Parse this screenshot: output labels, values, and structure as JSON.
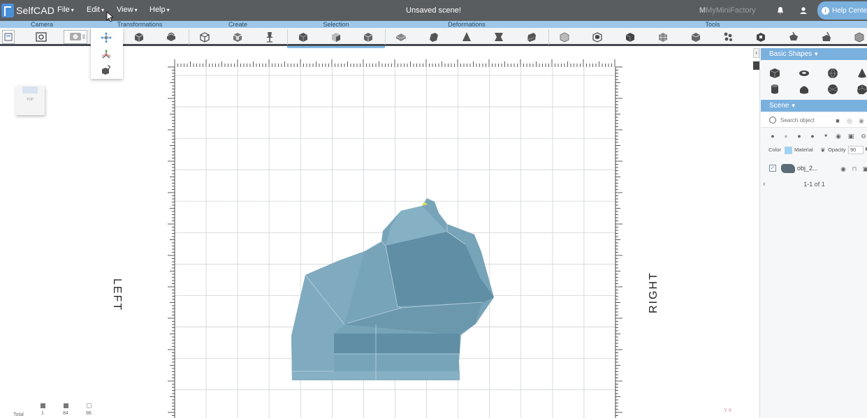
{
  "app": {
    "logo_text": "SelfCAD",
    "menus": [
      "File",
      "Edit",
      "View",
      "Help"
    ],
    "document_title": "Unsaved scene!",
    "partner_prefix": "M",
    "partner_name": "MyMiniFactory",
    "help_label": "Help Center",
    "accent": "#7ab0de",
    "topbar_color": "#5a5d60"
  },
  "ribbon": {
    "groups": [
      "Camera",
      "Transformations",
      "Create",
      "Selection",
      "Deformations",
      "Tools"
    ],
    "camera_tools": [
      "camera-top-view",
      "camera-reset",
      "camera-screenshot"
    ],
    "transform_tools": [
      "move",
      "rotate",
      "scale"
    ],
    "create_tools": [
      "box",
      "extrude",
      "pin"
    ],
    "selection_tools": [
      "select-face",
      "select-object",
      "select-edge"
    ],
    "deformation_tools": [
      "deform-1",
      "deform-2",
      "deform-3",
      "deform-4",
      "deform-5"
    ],
    "tools_tools": [
      "tool-1",
      "tool-2",
      "tool-3",
      "tool-4",
      "tool-5",
      "tool-6",
      "tool-7",
      "tool-8",
      "tool-9",
      "tool-10"
    ],
    "dropdown_items": [
      "move-gizmo",
      "rotate-gizmo",
      "scale-gizmo"
    ]
  },
  "viewport": {
    "view_cube_label": "TOP",
    "left_label": "LEFT",
    "right_label": "RIGHT",
    "model_color": "#78a4b9",
    "stats": {
      "label": "Total",
      "values": [
        "1",
        "84",
        "86"
      ]
    },
    "axis_hint": "Y X"
  },
  "panel": {
    "basic_shapes_header": "Basic Shapes",
    "shapes": [
      "cube",
      "torus",
      "sphere",
      "cone",
      "cylinder",
      "tube",
      "sphere-2",
      "dodecahedron"
    ],
    "scene_header": "Scene",
    "search_placeholder": "Search object",
    "color_label": "Color",
    "color_value": "#9ed4f5",
    "material_label": "Material",
    "opacity_label": "Opacity",
    "opacity_value": "90",
    "object_name": "obj_2...",
    "object_visible": true,
    "pagination": "1-1 of 1"
  }
}
